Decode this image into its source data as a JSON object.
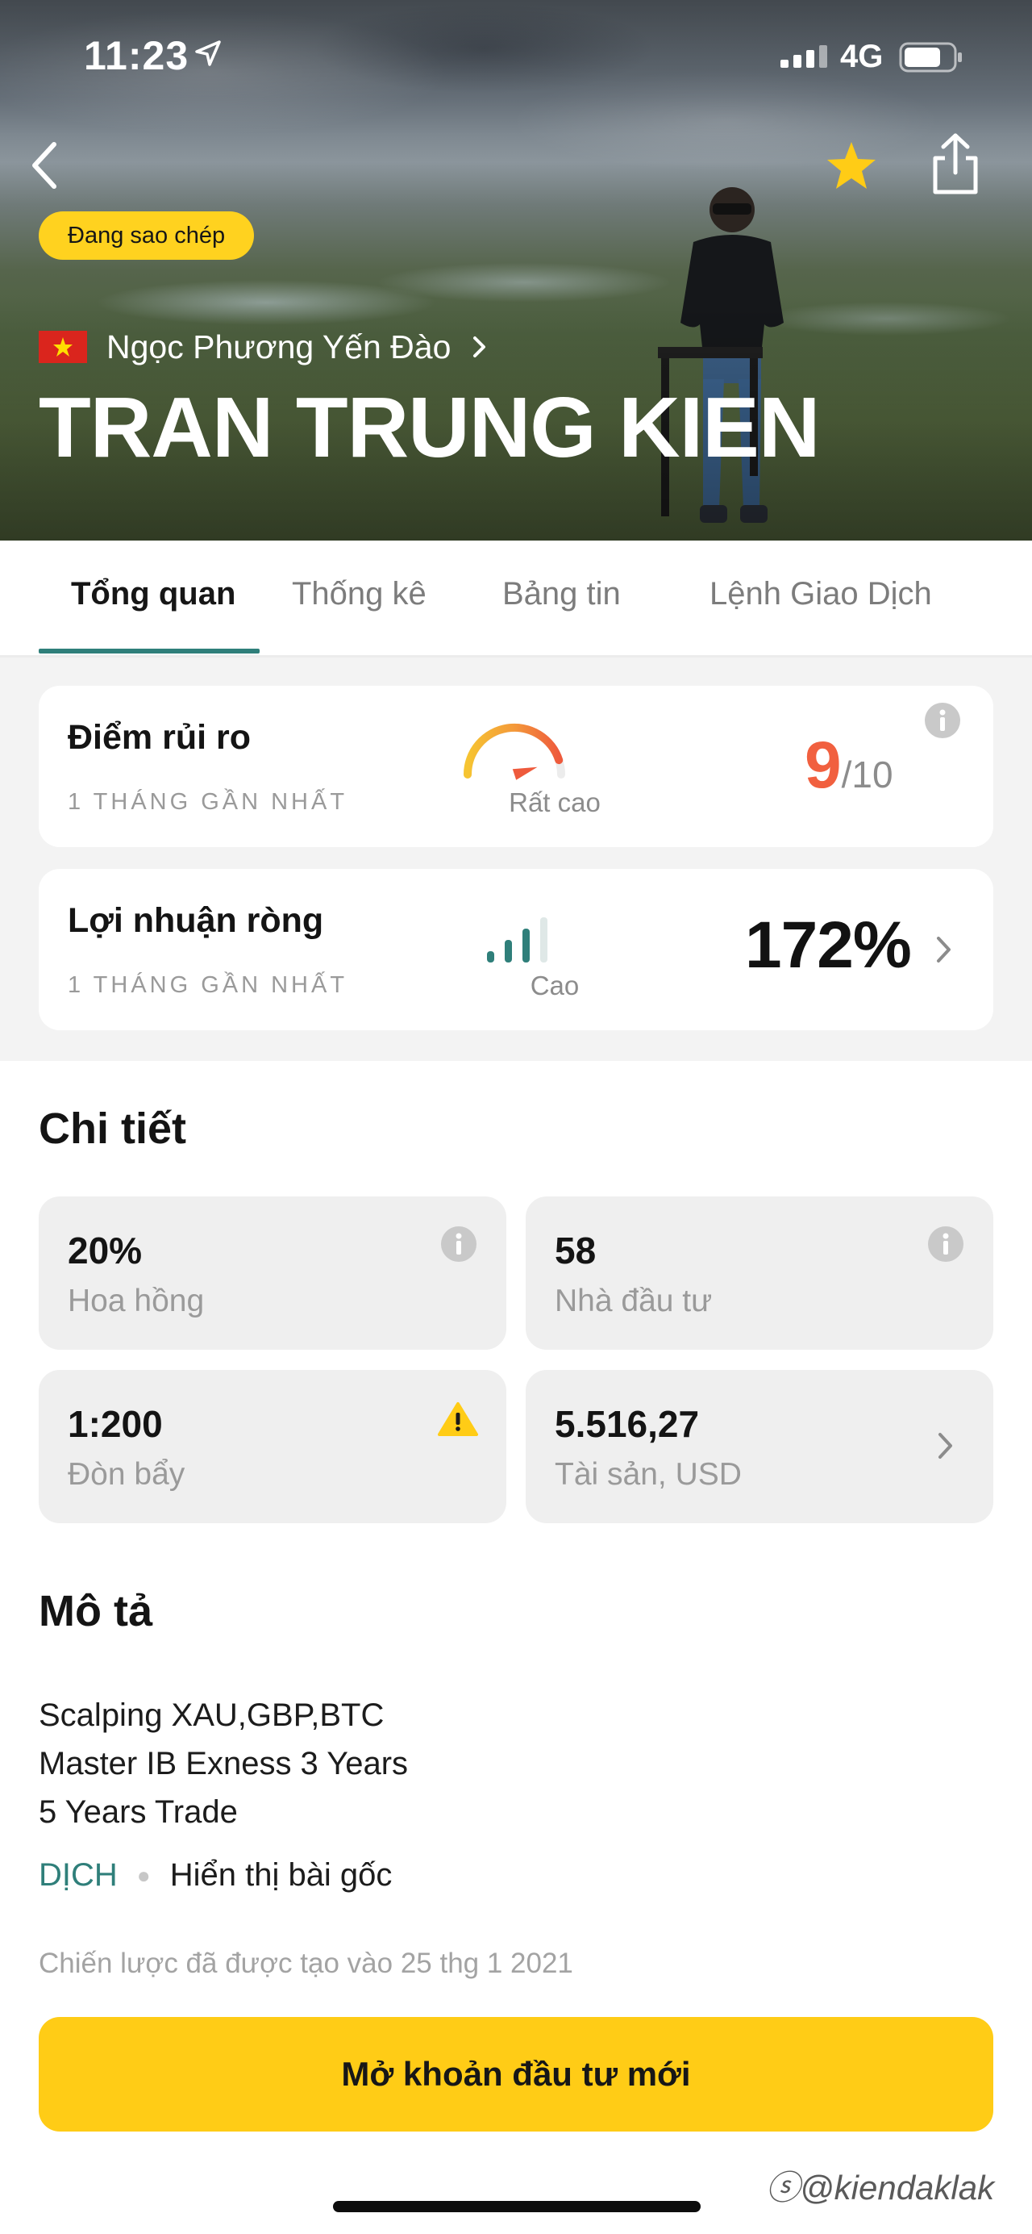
{
  "status_bar": {
    "time": "11:23",
    "network": "4G"
  },
  "hero": {
    "badge": "Đang sao chép",
    "owner": "Ngọc Phương Yến Đào",
    "title": "TRAN TRUNG KIEN"
  },
  "tabs": [
    {
      "label": "Tổng quan",
      "active": true
    },
    {
      "label": "Thống kê",
      "active": false
    },
    {
      "label": "Bảng tin",
      "active": false
    },
    {
      "label": "Lệnh Giao Dịch",
      "active": false
    }
  ],
  "risk_card": {
    "title": "Điểm rủi ro",
    "period": "1 THÁNG GẦN NHẤT",
    "gauge_label": "Rất cao",
    "score": "9",
    "max": "/10",
    "gauge_level": 0.9,
    "score_color": "#f1603f"
  },
  "profit_card": {
    "title": "Lợi nhuận ròng",
    "period": "1 THÁNG GẦN NHẤT",
    "level_label": "Cao",
    "value": "172%",
    "bars_filled": 3,
    "bars_total": 4,
    "bar_color": "#2f7f7a"
  },
  "details": {
    "title": "Chi tiết",
    "commission": {
      "value": "20%",
      "label": "Hoa hồng"
    },
    "investors": {
      "value": "58",
      "label": "Nhà đầu tư"
    },
    "leverage": {
      "value": "1:200",
      "label": "Đòn bẩy"
    },
    "assets": {
      "value": "5.516,27",
      "label": "Tài sản, USD"
    }
  },
  "description": {
    "title": "Mô tả",
    "lines": [
      "Scalping XAU,GBP,BTC",
      "Master IB Exness 3 Years",
      "5 Years Trade"
    ],
    "translate": "DỊCH",
    "show_original": "Hiển thị bài gốc",
    "created": "Chiến lược đã được tạo vào 25 thg 1 2021"
  },
  "cta": {
    "label": "Mở khoản đầu tư mới"
  },
  "watermark": "@kiendaklak",
  "colors": {
    "accent": "#2f7f7a",
    "yellow": "#ffcc16",
    "badge_yellow": "#ffd21f",
    "risk": "#f1603f"
  }
}
